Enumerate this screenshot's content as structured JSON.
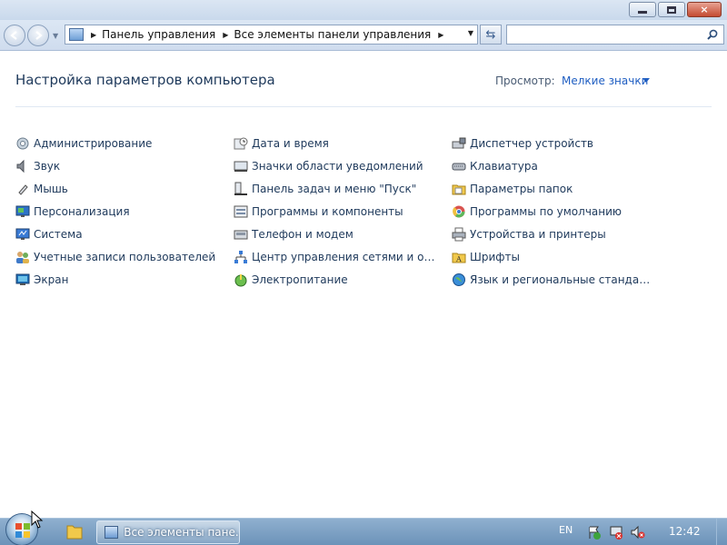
{
  "window": {
    "buttons": {
      "minimize": "minimize",
      "maximize": "maximize",
      "close": "×"
    }
  },
  "nav": {
    "breadcrumbs": [
      "Панель управления",
      "Все элементы панели управления"
    ],
    "search_placeholder": ""
  },
  "main": {
    "title": "Настройка параметров компьютера",
    "view_by_label": "Просмотр:",
    "view_by_value": "Мелкие значки"
  },
  "items": {
    "col0": [
      {
        "label": "Администрирование",
        "icon": "admin-tools-icon"
      },
      {
        "label": "Звук",
        "icon": "speaker-icon"
      },
      {
        "label": "Мышь",
        "icon": "mouse-icon"
      },
      {
        "label": "Персонализация",
        "icon": "personalization-icon"
      },
      {
        "label": "Система",
        "icon": "system-icon"
      },
      {
        "label": "Учетные записи пользователей",
        "icon": "users-icon"
      },
      {
        "label": "Экран",
        "icon": "display-icon"
      }
    ],
    "col1": [
      {
        "label": "Дата и время",
        "icon": "clock-icon"
      },
      {
        "label": "Значки области уведомлений",
        "icon": "tray-icons-icon"
      },
      {
        "label": "Панель задач и меню \"Пуск\"",
        "icon": "taskbar-icon"
      },
      {
        "label": "Программы и компоненты",
        "icon": "programs-icon"
      },
      {
        "label": "Телефон и модем",
        "icon": "phone-modem-icon"
      },
      {
        "label": "Центр управления сетями и общи...",
        "icon": "network-icon"
      },
      {
        "label": "Электропитание",
        "icon": "power-icon"
      }
    ],
    "col2": [
      {
        "label": "Диспетчер устройств",
        "icon": "device-manager-icon"
      },
      {
        "label": "Клавиатура",
        "icon": "keyboard-icon"
      },
      {
        "label": "Параметры папок",
        "icon": "folder-options-icon"
      },
      {
        "label": "Программы по умолчанию",
        "icon": "default-programs-icon"
      },
      {
        "label": "Устройства и принтеры",
        "icon": "printer-icon"
      },
      {
        "label": "Шрифты",
        "icon": "fonts-icon"
      },
      {
        "label": "Язык и региональные стандарты",
        "icon": "globe-icon"
      }
    ]
  },
  "taskbar": {
    "window_label": "Все элементы пане...",
    "language": "EN",
    "clock": "12:42"
  }
}
